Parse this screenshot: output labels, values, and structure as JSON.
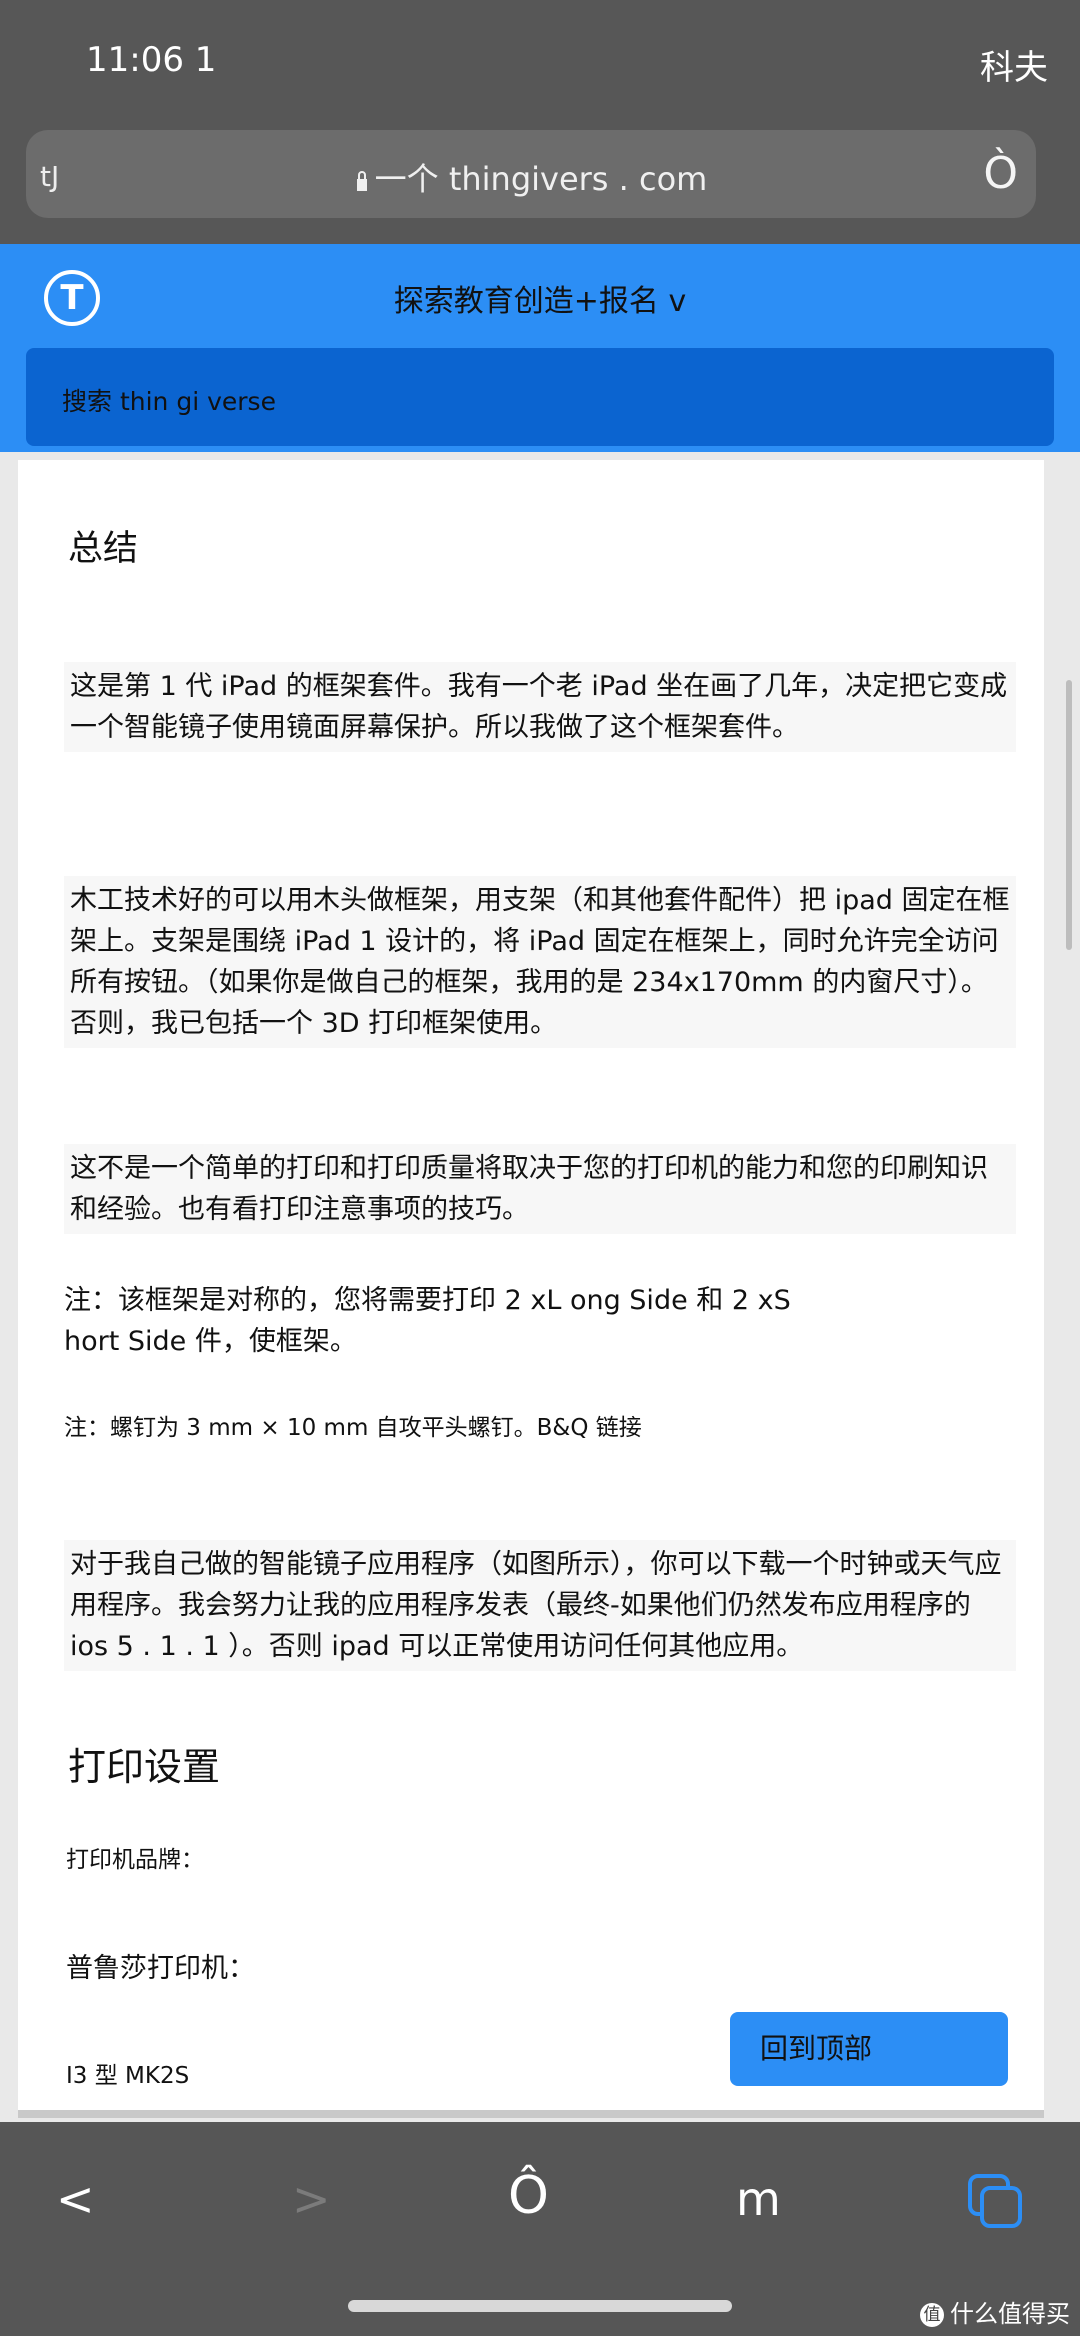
{
  "status": {
    "time": "11:06 1",
    "carrier": "科夫"
  },
  "address_bar": {
    "left_text": "tJ",
    "url": "一个 thingivers . com",
    "right_glyph": "Ò"
  },
  "header": {
    "logo_letter": "T",
    "nav": "探索教育创造+报名 v",
    "search_placeholder": "搜索 thin gi verse"
  },
  "content": {
    "summary_heading": "总结",
    "p1": "这是第 1 代 iPad 的框架套件。我有一个老 iPad 坐在画了几年，决定把它变成一个智能镜子使用镜面屏幕保护。所以我做了这个框架套件。",
    "p2": "木工技术好的可以用木头做框架，用支架（和其他套件配件）把 ipad 固定在框架上。支架是围绕 iPad 1 设计的，将 iPad 固定在框架上，同时允许完全访问所有按钮。（如果你是做自己的框架，我用的是 234x170mm 的内窗尺寸）。否则，我已包括一个 3D 打印框架使用。",
    "p3": "这不是一个简单的打印和打印质量将取决于您的打印机的能力和您的印刷知识和经验。也有看打印注意事项的技巧。",
    "note1_line1": "注：该框架是对称的，您将需要打印 2 xL ong Side 和 2 xS",
    "note1_line2": "hort Side 件，使框架。",
    "note2": "注：螺钉为 3 mm × 10 mm 自攻平头螺钉。B&Q 链接",
    "p4": "对于我自己做的智能镜子应用程序（如图所示），你可以下载一个时钟或天气应用程序。我会努力让我的应用程序发表（最终-如果他们仍然发布应用程序的 ios 5 . 1 . 1 ）。否则 ipad 可以正常使用访问任何其他应用。",
    "print_heading": "打印设置",
    "printer_brand_label": "打印机品牌：",
    "printer_label": "普鲁莎打印机：",
    "printer_model": "I3 型 MK2S",
    "back_to_top": "回到顶部"
  },
  "toolbar": {
    "back": "<",
    "forward": ">",
    "share": "Ô",
    "bookmarks": "m"
  },
  "watermark": {
    "icon_text": "值",
    "text": "什么值得买"
  }
}
